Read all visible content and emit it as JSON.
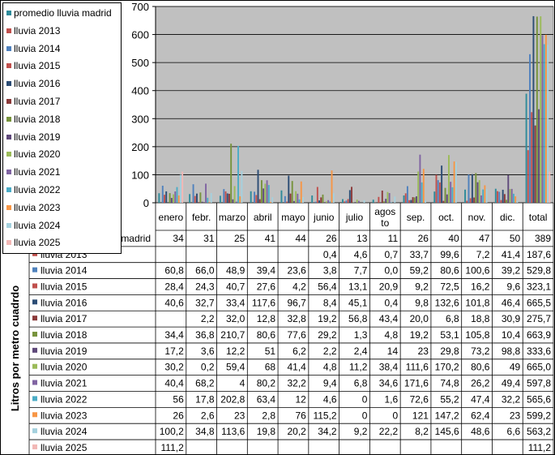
{
  "chart_data": {
    "type": "bar",
    "ylabel": "Litros por metro cuadrdo",
    "ylim": [
      0,
      700
    ],
    "yticks": [
      0,
      100,
      200,
      300,
      400,
      500,
      600,
      700
    ],
    "plot_background": "#c0c0c0",
    "grid": true,
    "legend_position": "top-left",
    "categories": [
      "enero",
      "febr.",
      "marzo",
      "abril",
      "mayo",
      "junio",
      "julio",
      "agosto",
      "sep.",
      "oct.",
      "nov.",
      "dic.",
      "total"
    ],
    "table_header_first": "madrid",
    "series": [
      {
        "name": "promedio lluvia madrid",
        "color": "#2e8b9a",
        "table_label": "madrid",
        "values": [
          "34",
          "31",
          "25",
          "41",
          "44",
          "26",
          "13",
          "11",
          "26",
          "40",
          "47",
          "50",
          "389"
        ]
      },
      {
        "name": "lluvia 2013",
        "color": "#c0504d",
        "table_label": "lluvia 2013",
        "values": [
          "",
          "",
          "",
          "",
          "",
          "0,4",
          "4,6",
          "0,7",
          "33,7",
          "99,6",
          "7,2",
          "41,4",
          "187,6"
        ]
      },
      {
        "name": "lluvia 2014",
        "color": "#4f81bd",
        "table_label": "lluvia 2014",
        "values": [
          "60,8",
          "66,0",
          "48,9",
          "39,4",
          "23,6",
          "3,8",
          "7,7",
          "0,0",
          "59,2",
          "80,6",
          "100,6",
          "39,2",
          "529,8"
        ]
      },
      {
        "name": "lluvia 2015",
        "color": "#c0504d",
        "table_label": "lluvia 2015",
        "values": [
          "28,4",
          "24,3",
          "40,7",
          "27,6",
          "4,2",
          "56,4",
          "13,1",
          "20,9",
          "9,2",
          "72,5",
          "16,2",
          "9,6",
          "323,1"
        ]
      },
      {
        "name": "lluvia 2016",
        "color": "#2c4d75",
        "table_label": "lluvia 2016",
        "values": [
          "40,6",
          "32,7",
          "33,4",
          "117,6",
          "96,7",
          "8,4",
          "45,1",
          "0,4",
          "9,8",
          "132,6",
          "101,8",
          "46,4",
          "665,5"
        ]
      },
      {
        "name": "lluvia 2017",
        "color": "#8b3a3a",
        "table_label": "lluvia 2017",
        "values": [
          "",
          "2,2",
          "32,0",
          "12,8",
          "32,8",
          "19,2",
          "56,8",
          "43,4",
          "20,0",
          "6,8",
          "18,8",
          "30,9",
          "275,7"
        ]
      },
      {
        "name": "lluvia 2018",
        "color": "#77933c",
        "table_label": "lluvia 2018",
        "values": [
          "34,4",
          "36,8",
          "210,7",
          "80,6",
          "77,6",
          "29,2",
          "1,3",
          "4,8",
          "19,2",
          "53,1",
          "105,8",
          "10,4",
          "663,9"
        ]
      },
      {
        "name": "lluvia 2019",
        "color": "#5f497a",
        "table_label": "lluvia 2019",
        "values": [
          "17,2",
          "3,6",
          "12,2",
          "51",
          "6,2",
          "2,2",
          "2,4",
          "14",
          "23",
          "29,8",
          "73,2",
          "98,8",
          "333,6"
        ]
      },
      {
        "name": "lluvia 2020",
        "color": "#9bbb59",
        "table_label": "lluvia 2020",
        "values": [
          "30,2",
          "0,2",
          "59,4",
          "68",
          "41,4",
          "4,8",
          "11,2",
          "38,4",
          "111,6",
          "170,2",
          "80,6",
          "49",
          "665,0"
        ]
      },
      {
        "name": "lluvia 2021",
        "color": "#8064a2",
        "table_label": "lluvia 2021",
        "values": [
          "40,4",
          "68,2",
          "4",
          "80,2",
          "32,2",
          "9,4",
          "6,8",
          "34,6",
          "171,6",
          "74,8",
          "26,2",
          "49,4",
          "597,8"
        ]
      },
      {
        "name": "lluvia 2022",
        "color": "#4bacc6",
        "table_label": "lluvia 2022",
        "values": [
          "56",
          "17,8",
          "202,8",
          "63,4",
          "12",
          "4,6",
          "0",
          "1,6",
          "72,6",
          "55,2",
          "47,4",
          "32,2",
          "565,6"
        ]
      },
      {
        "name": "lluvia 2023",
        "color": "#f79646",
        "table_label": "lluvia 2023",
        "values": [
          "26",
          "2,6",
          "23",
          "2,8",
          "76",
          "115,2",
          "0",
          "0",
          "121",
          "147,2",
          "62,4",
          "23",
          "599,2"
        ]
      },
      {
        "name": "lluvia 2024",
        "color": "#a5d1de",
        "table_label": "lluvia 2024",
        "values": [
          "100,2",
          "34,8",
          "113,6",
          "19,8",
          "20,2",
          "34,2",
          "9,2",
          "22,2",
          "8,2",
          "145,6",
          "48,6",
          "6,6",
          "563,2"
        ]
      },
      {
        "name": "lluvia 2025",
        "color": "#f2b8b6",
        "table_label": "lluvia 2025",
        "values": [
          "111,2",
          "",
          "",
          "",
          "",
          "",
          "",
          "",
          "",
          "",
          "",
          "",
          "111,2"
        ]
      }
    ]
  }
}
